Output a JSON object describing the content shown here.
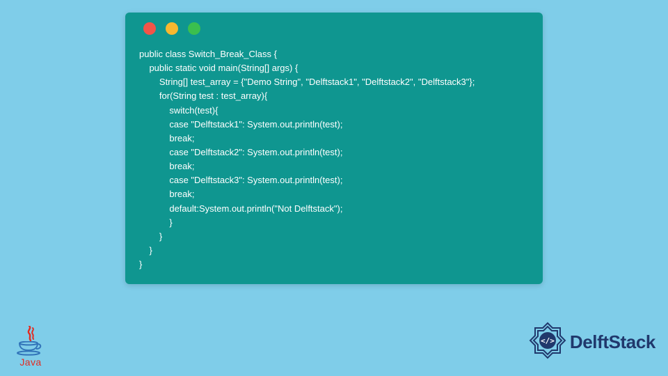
{
  "traffic_lights": [
    "red",
    "yellow",
    "green"
  ],
  "code": {
    "l1": "public class Switch_Break_Class {",
    "l2": "    public static void main(String[] args) {",
    "l3": "        String[] test_array = {\"Demo String\", \"Delftstack1\", \"Delftstack2\", \"Delftstack3\"};",
    "l4": "        for(String test : test_array){",
    "l5": "            switch(test){",
    "l6": "            case \"Delftstack1\": System.out.println(test);",
    "l7": "            break;",
    "l8": "            case \"Delftstack2\": System.out.println(test);",
    "l9": "            break;",
    "l10": "            case \"Delftstack3\": System.out.println(test);",
    "l11": "            break;",
    "l12": "            default:System.out.println(\"Not Delftstack\");",
    "l13": "            }",
    "l14": "        }",
    "l15": "    }",
    "l16": "}"
  },
  "java_logo_text": "Java",
  "delftstack_text": "DelftStack",
  "colors": {
    "bg": "#7fcde9",
    "window": "#0f9690",
    "java_red": "#e22b22",
    "java_blue": "#3174b9",
    "delft_blue": "#20386c"
  }
}
